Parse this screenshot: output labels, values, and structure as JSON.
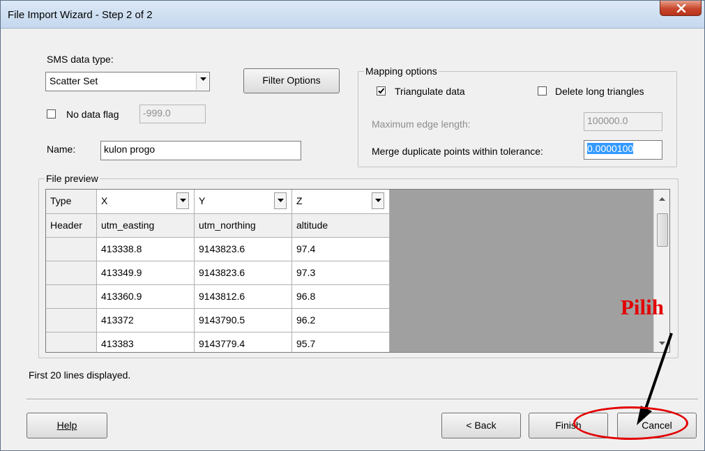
{
  "window": {
    "title": "File Import Wizard - Step 2 of 2"
  },
  "data_type": {
    "label": "SMS data type:",
    "value": "Scatter Set"
  },
  "filter_button": "Filter Options",
  "no_data": {
    "label": "No data flag",
    "value": "-999.0",
    "checked": false
  },
  "name": {
    "label": "Name:",
    "value": "kulon progo"
  },
  "mapping": {
    "legend": "Mapping options",
    "triangulate": {
      "label": "Triangulate data",
      "checked": true
    },
    "delete_long": {
      "label": "Delete long triangles",
      "checked": false
    },
    "max_edge": {
      "label": "Maximum edge length:",
      "value": "100000.0"
    },
    "merge": {
      "label": "Merge duplicate points within tolerance:",
      "value": "0.0000100"
    }
  },
  "preview": {
    "legend": "File preview",
    "corner_type": "Type",
    "corner_header": "Header",
    "columns": [
      {
        "type": "X",
        "header": "utm_easting"
      },
      {
        "type": "Y",
        "header": "utm_northing"
      },
      {
        "type": "Z",
        "header": "altitude"
      }
    ],
    "rows": [
      [
        "413338.8",
        "9143823.6",
        "97.4"
      ],
      [
        "413349.9",
        "9143823.6",
        "97.3"
      ],
      [
        "413360.9",
        "9143812.6",
        "96.8"
      ],
      [
        "413372",
        "9143790.5",
        "96.2"
      ],
      [
        "413383",
        "9143779.4",
        "95.7"
      ]
    ],
    "footer": "First 20 lines displayed."
  },
  "buttons": {
    "help": "Help",
    "back": "< Back",
    "finish": "Finish",
    "cancel": "Cancel"
  },
  "annotation": {
    "text": "Pilih",
    "color": "#e30000"
  }
}
